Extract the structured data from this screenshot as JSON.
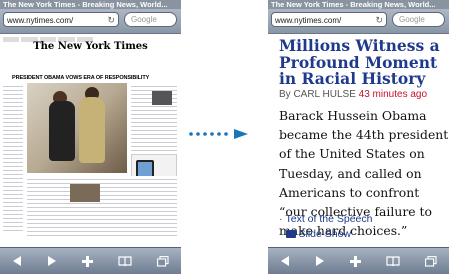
{
  "browser": {
    "window_title": "The New York Times - Breaking News, World...",
    "url": "www.nytimes.com/",
    "search_placeholder": "Google"
  },
  "left_page": {
    "masthead": "The New York Times",
    "top_headline": "PRESIDENT OBAMA VOWS ERA OF RESPONSIBILITY"
  },
  "article": {
    "headline": "Millions Witness a Profound Moment in Racial History",
    "byline_author": "By CARL HULSE",
    "byline_time": "43 minutes ago",
    "body": "Barack Hussein Obama became the 44th president of the United States on Tuesday, and called on Americans to confront “our collective failure to make hard choices.”",
    "links": [
      "Text of the Speech",
      "Slide Show"
    ]
  },
  "icons": {
    "back": "back-arrow-icon",
    "forward": "forward-arrow-icon",
    "add": "plus-icon",
    "bookmarks": "book-icon",
    "pages": "pages-icon",
    "reload": "reload-icon",
    "transition_arrow": "dotted-arrow-icon"
  },
  "colors": {
    "headline_link": "#1f3a8c",
    "timestamp": "#c8102e",
    "toolbar": "#6e7d91",
    "arrow": "#1b74b8"
  }
}
